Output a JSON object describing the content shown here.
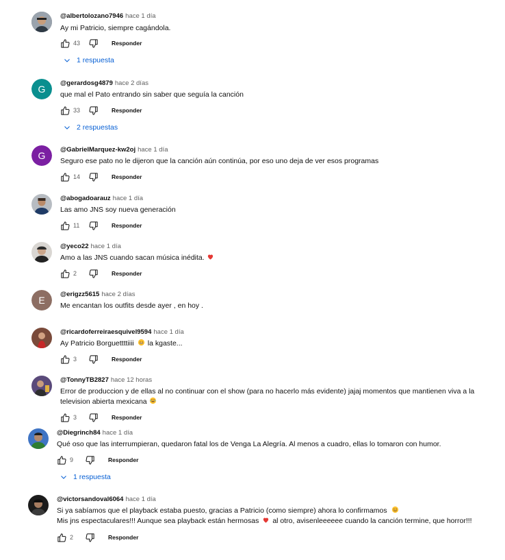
{
  "reply_label": "Responder",
  "comments": [
    {
      "author": "@albertolozano7946",
      "time": "hace 1 día",
      "lines": [
        "Ay mi Patricio, siempre cagándola."
      ],
      "likes": "43",
      "replies": "1 respuesta"
    },
    {
      "author": "@gerardosg4879",
      "time": "hace 2 días",
      "lines": [
        "que mal el Pato entrando sin saber que seguía la canción"
      ],
      "likes": "33",
      "replies": "2 respuestas",
      "avatar_letter": "G",
      "avatar_color": "#0a8f8f"
    },
    {
      "author": "@GabrielMarquez-kw2oj",
      "time": "hace 1 día",
      "lines": [
        "Seguro ese pato no le dijeron que la canción aún continúa, por eso uno deja de ver esos programas"
      ],
      "likes": "14",
      "avatar_letter": "G",
      "avatar_color": "#7b1fa2"
    },
    {
      "author": "@abogadoarauz",
      "time": "hace 1 día",
      "lines": [
        "Las amo JNS soy nueva generación"
      ],
      "likes": "11"
    },
    {
      "author": "@yeco22",
      "time": "hace 1 día",
      "lines": [
        "Amo a las JNS cuando sacan música inédita."
      ],
      "likes": "2"
    },
    {
      "author": "@erigzz5615",
      "time": "hace 2 días",
      "lines": [
        "Me encantan los outfits desde ayer , en hoy ."
      ],
      "likes": "",
      "avatar_letter": "E",
      "avatar_color": "#8d6e63"
    },
    {
      "author": "@ricardoferreiraesquivel9594",
      "time": "hace 1 día",
      "lines": [
        "Ay Patricio Borguettttiiii",
        "la kgaste..."
      ],
      "likes": "3"
    },
    {
      "author": "@TonnyTB2827",
      "time": "hace 12 horas",
      "lines": [
        "Error de produccion y de ellas al no continuar con el show (para no hacerlo más evidente) jajaj momentos que mantienen viva a la",
        "television abierta mexicana"
      ],
      "likes": "3"
    },
    {
      "author": "@Diegrinch84",
      "time": "hace 1 día",
      "lines": [
        "Qué oso que las interrumpieran, quedaron fatal los de Venga La Alegría. Al menos a cuadro, ellas lo tomaron con humor."
      ],
      "likes": "9",
      "replies": "1 respuesta"
    },
    {
      "author": "@victorsandoval6064",
      "time": "hace 1 día",
      "lines": [
        "Si ya sabíamos que el playback estaba puesto, gracias a Patricio (como siempre) ahora lo confirmamos",
        "Mis jns espectaculares!!! Aunque sea playback están hermosas",
        "al otro, avisenleeeeee cuando la canción termine, que horror!!!"
      ],
      "likes": "2"
    }
  ]
}
